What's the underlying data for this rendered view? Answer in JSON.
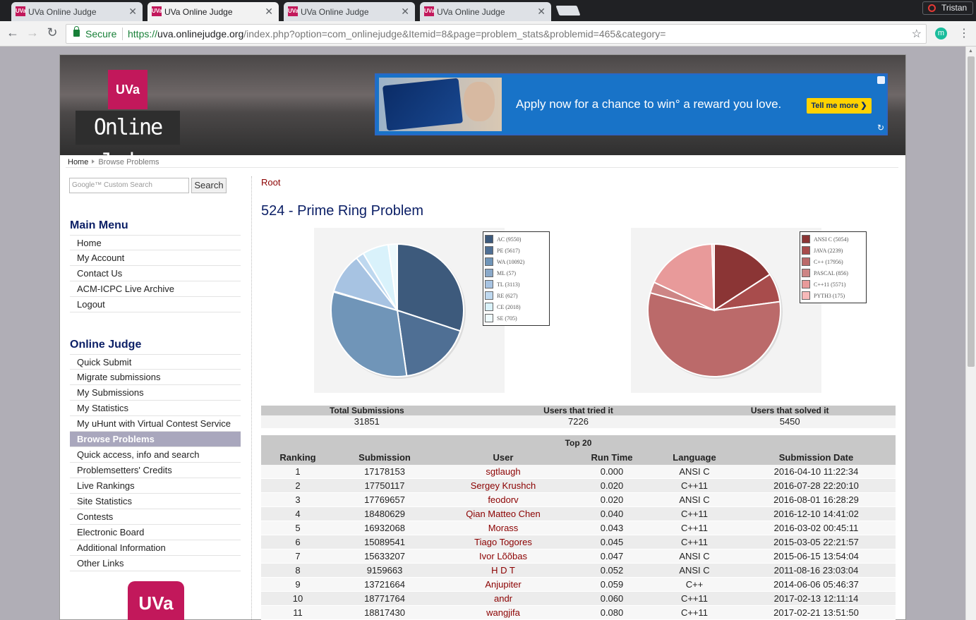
{
  "browser": {
    "tabs": [
      {
        "title": "UVa Online Judge",
        "active": false
      },
      {
        "title": "UVa Online Judge",
        "active": true
      },
      {
        "title": "UVa Online Judge",
        "active": false
      },
      {
        "title": "UVa Online Judge",
        "active": false
      }
    ],
    "favicon_text": "UVa",
    "profile_name": "Tristan",
    "secure_label": "Secure",
    "url_scheme": "https://",
    "url_domain": "uva.onlinejudge.org",
    "url_path": "/index.php?option=com_onlinejudge&Itemid=8&page=problem_stats&problemid=465&category=",
    "extension_letter": "m"
  },
  "header": {
    "logo_mark": "UVa",
    "logo_text": "Online Judge",
    "ad_text": "Apply now for a chance to win° a reward you love.",
    "ad_button": "Tell me more ❯"
  },
  "breadcrumb": {
    "home": "Home",
    "current": "Browse Problems"
  },
  "search": {
    "placeholder": "Google™ Custom Search",
    "button": "Search"
  },
  "main_menu": {
    "title": "Main Menu",
    "items": [
      "Home",
      "My Account",
      "Contact Us",
      "ACM-ICPC Live Archive",
      "Logout"
    ]
  },
  "judge_menu": {
    "title": "Online Judge",
    "items": [
      "Quick Submit",
      "Migrate submissions",
      "My Submissions",
      "My Statistics",
      "My uHunt with Virtual Contest Service",
      "Browse Problems",
      "Quick access, info and search",
      "Problemsetters' Credits",
      "Live Rankings",
      "Site Statistics",
      "Contests",
      "Electronic Board",
      "Additional Information",
      "Other Links"
    ],
    "active_index": 5
  },
  "bottom_badge": "UVa",
  "content": {
    "root_link": "Root",
    "problem_title": "524 - Prime Ring Problem"
  },
  "verdict_chart": {
    "type": "pie",
    "labels": [
      "AC (9550)",
      "PE (5617)",
      "WA (10092)",
      "ML (57)",
      "TL (3113)",
      "RE (627)",
      "CE (2018)",
      "SE (705)"
    ],
    "values": [
      9550,
      5617,
      10092,
      57,
      3113,
      627,
      2018,
      705
    ],
    "colors": [
      "#3d5a7c",
      "#4f6f94",
      "#7095b8",
      "#8aa9c9",
      "#a7c3e2",
      "#bed8ef",
      "#d9f2fb",
      "#eefafd"
    ]
  },
  "language_chart": {
    "type": "pie",
    "labels": [
      "ANSI C (5054)",
      "JAVA (2239)",
      "C++ (17956)",
      "PASCAL (856)",
      "C++11 (5571)",
      "PYTH3 (175)"
    ],
    "values": [
      5054,
      2239,
      17956,
      856,
      5571,
      175
    ],
    "colors": [
      "#8b3535",
      "#a84c4c",
      "#bb6a6a",
      "#cd8585",
      "#e89a9a",
      "#f7b9b9"
    ]
  },
  "stats": {
    "headers": [
      "Total Submissions",
      "Users that tried it",
      "Users that solved it"
    ],
    "values": [
      "31851",
      "7226",
      "5450"
    ]
  },
  "top20": {
    "title": "Top 20",
    "headers": [
      "Ranking",
      "Submission",
      "User",
      "Run Time",
      "Language",
      "Submission Date"
    ],
    "rows": [
      [
        "1",
        "17178153",
        "sgtlaugh",
        "0.000",
        "ANSI C",
        "2016-04-10 11:22:34"
      ],
      [
        "2",
        "17750117",
        "Sergey Krushch",
        "0.020",
        "C++11",
        "2016-07-28 22:20:10"
      ],
      [
        "3",
        "17769657",
        "feodorv",
        "0.020",
        "ANSI C",
        "2016-08-01 16:28:29"
      ],
      [
        "4",
        "18480629",
        "Qian Matteo Chen",
        "0.040",
        "C++11",
        "2016-12-10 14:41:02"
      ],
      [
        "5",
        "16932068",
        "Morass",
        "0.043",
        "C++11",
        "2016-03-02 00:45:11"
      ],
      [
        "6",
        "15089541",
        "Tiago Togores",
        "0.045",
        "C++11",
        "2015-03-05 22:21:57"
      ],
      [
        "7",
        "15633207",
        "Ivor Lõõbas",
        "0.047",
        "ANSI C",
        "2015-06-15 13:54:04"
      ],
      [
        "8",
        "9159663",
        "H D T",
        "0.052",
        "ANSI C",
        "2011-08-16 23:03:04"
      ],
      [
        "9",
        "13721664",
        "Anjupiter",
        "0.059",
        "C++",
        "2014-06-06 05:46:37"
      ],
      [
        "10",
        "18771764",
        "andr",
        "0.060",
        "C++11",
        "2017-02-13 12:11:14"
      ],
      [
        "11",
        "18817430",
        "wangjifa",
        "0.080",
        "C++11",
        "2017-02-21 13:51:50"
      ]
    ]
  }
}
